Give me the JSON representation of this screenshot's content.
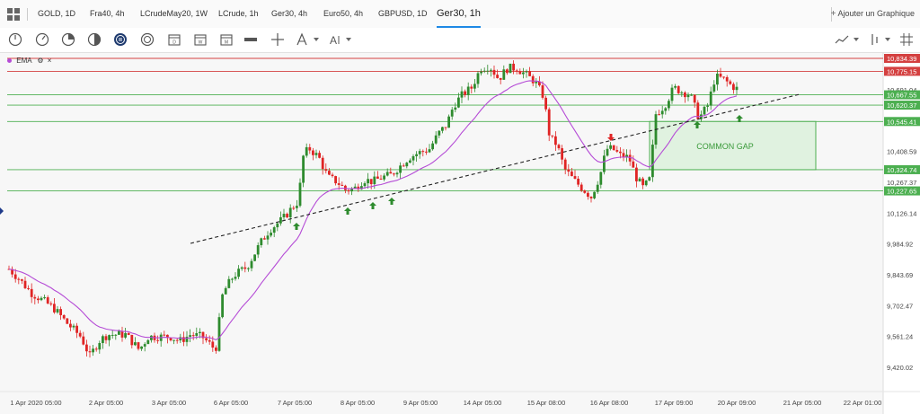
{
  "tabs": [
    {
      "label": "GOLD, 1D",
      "active": false
    },
    {
      "label": "Fra40, 4h",
      "active": false
    },
    {
      "label": "LCrudeMay20, 1W",
      "active": false
    },
    {
      "label": "LCrude, 1h",
      "active": false
    },
    {
      "label": "Ger30, 4h",
      "active": false
    },
    {
      "label": "Euro50, 4h",
      "active": false
    },
    {
      "label": "GBPUSD, 1D",
      "active": false
    },
    {
      "label": "Ger30, 1h",
      "active": true
    }
  ],
  "add_chart_label": "Ajouter un Graphique",
  "toolbar_icons": [
    "clock-icon",
    "clock-icon",
    "pie-icon",
    "half-circle-icon",
    "info-icon",
    "circle-icon",
    "calendar-icon",
    "calendar-w-icon",
    "calendar-m-icon",
    "ruler-icon",
    "crosshair-icon",
    "pen-icon",
    "text-icon",
    "trendline-icon",
    "bars-icon",
    "grid-icon"
  ],
  "indicator": {
    "name": "EMA",
    "color": "#b54bd6"
  },
  "colors": {
    "up": "#2e8b2e",
    "down": "#e02424",
    "ema": "#b54bd6",
    "resistance": "#d44040",
    "support": "#4caf50",
    "gap_fill": "#e0f2e0",
    "axis_bg": "#ffffff",
    "active_tab": "#1e88e5"
  },
  "chart_data": {
    "type": "candlestick",
    "symbol": "Ger30",
    "timeframe": "1h",
    "y_ticks": [
      "10,408.59",
      "10,267.37",
      "10,126.14",
      "9,984.92",
      "9,843.69",
      "9,702.47",
      "9,561.24",
      "9,420.02"
    ],
    "x_ticks": [
      "1 Apr 2020 05:00",
      "2 Apr 05:00",
      "3 Apr 05:00",
      "6 Apr 05:00",
      "7 Apr 05:00",
      "8 Apr 05:00",
      "9 Apr 05:00",
      "14 Apr 05:00",
      "15 Apr 08:00",
      "16 Apr 08:00",
      "17 Apr 09:00",
      "20 Apr 09:00",
      "21 Apr 05:00",
      "22 Apr 01:00"
    ],
    "price_labels": [
      {
        "value": "10,834.39",
        "type": "resistance"
      },
      {
        "value": "10,775.15",
        "type": "resistance"
      },
      {
        "value": "10,691.04",
        "type": "last"
      },
      {
        "value": "10,667.55",
        "type": "support"
      },
      {
        "value": "10,620.37",
        "type": "support"
      },
      {
        "value": "10,545.41",
        "type": "support"
      },
      {
        "value": "10,324.74",
        "type": "support"
      },
      {
        "value": "10,227.65",
        "type": "support"
      }
    ],
    "annotations": [
      {
        "text": "COMMON GAP"
      }
    ],
    "signals": {
      "buy": 7,
      "sell": 1
    }
  }
}
